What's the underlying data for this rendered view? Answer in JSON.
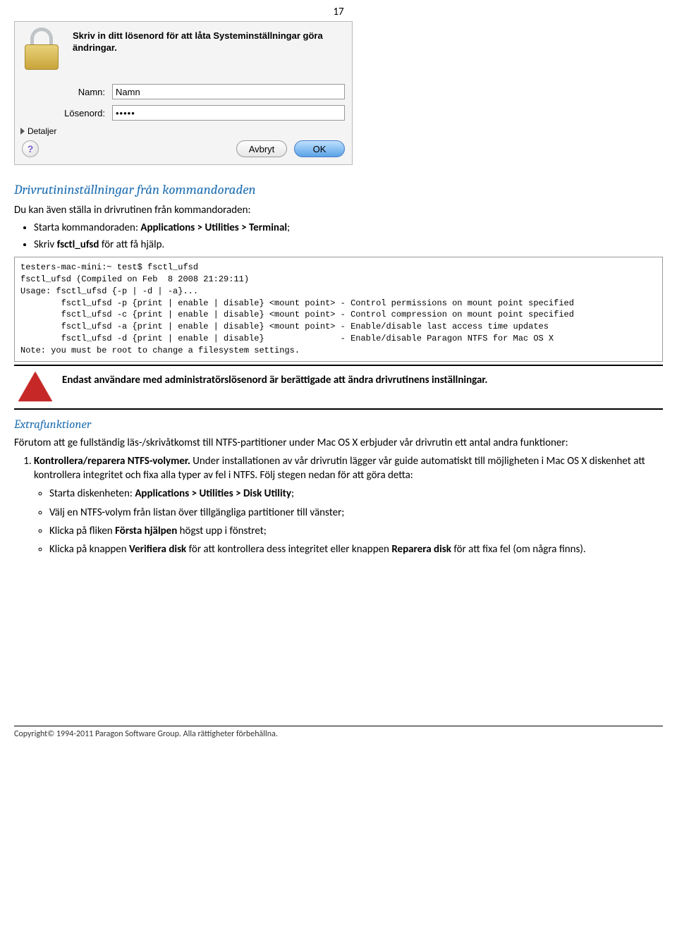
{
  "page_number": "17",
  "dialog": {
    "message": "Skriv in ditt lösenord för att låta Systeminställningar göra ändringar.",
    "name_label": "Namn:",
    "name_value": "Namn",
    "password_label": "Lösenord:",
    "password_value": "•••••",
    "details": "Detaljer",
    "help": "?",
    "cancel": "Avbryt",
    "ok": "OK"
  },
  "sec1_title": "Drivrutininställningar från kommandoraden",
  "sec1_intro": "Du kan även ställa in drivrutinen från kommandoraden:",
  "sec1_b1a": "Starta kommandoraden: ",
  "sec1_b1b": "Applications > Utilities > Terminal",
  "sec1_b1c": ";",
  "sec1_b2a": "Skriv ",
  "sec1_b2b": "fsctl_ufsd",
  "sec1_b2c": " för att få hjälp.",
  "terminal": "testers-mac-mini:~ test$ fsctl_ufsd\nfsctl_ufsd (Compiled on Feb  8 2008 21:29:11)\nUsage: fsctl_ufsd {-p | -d | -a}...\n        fsctl_ufsd -p {print | enable | disable} <mount point> - Control permissions on mount point specified\n        fsctl_ufsd -c {print | enable | disable} <mount point> - Control compression on mount point specified\n        fsctl_ufsd -a {print | enable | disable} <mount point> - Enable/disable last access time updates\n        fsctl_ufsd -d {print | enable | disable}               - Enable/disable Paragon NTFS for Mac OS X\nNote: you must be root to change a filesystem settings.",
  "warning": "Endast användare med administratörslösenord är berättigade att ändra drivrutinens inställningar.",
  "sec2_title": "Extrafunktioner",
  "sec2_intro": "Förutom att ge fullständig läs-/skrivåtkomst till NTFS-partitioner under Mac OS X erbjuder vår drivrutin ett antal andra funktioner:",
  "li1_a": "Kontrollera/reparera NTFS-volymer.",
  "li1_b": " Under installationen av vår drivrutin lägger vår guide automatiskt till möjligheten i Mac OS X diskenhet att kontrollera integritet och fixa alla typer av fel i NTFS. Följ stegen nedan för att göra detta:",
  "sb1a": "Starta diskenheten: ",
  "sb1b": "Applications > Utilities > Disk Utility",
  "sb1c": ";",
  "sb2": "Välj en NTFS-volym från listan över tillgängliga partitioner till vänster;",
  "sb3a": "Klicka på fliken ",
  "sb3b": "Första hjälpen",
  "sb3c": " högst upp i fönstret;",
  "sb4a": "Klicka på knappen ",
  "sb4b": "Verifiera disk",
  "sb4c": " för att kontrollera dess integritet eller knappen ",
  "sb4d": "Reparera disk",
  "sb4e": " för att fixa fel (om några finns).",
  "footer": "Copyright© 1994-2011 Paragon Software Group. Alla rättigheter förbehållna."
}
